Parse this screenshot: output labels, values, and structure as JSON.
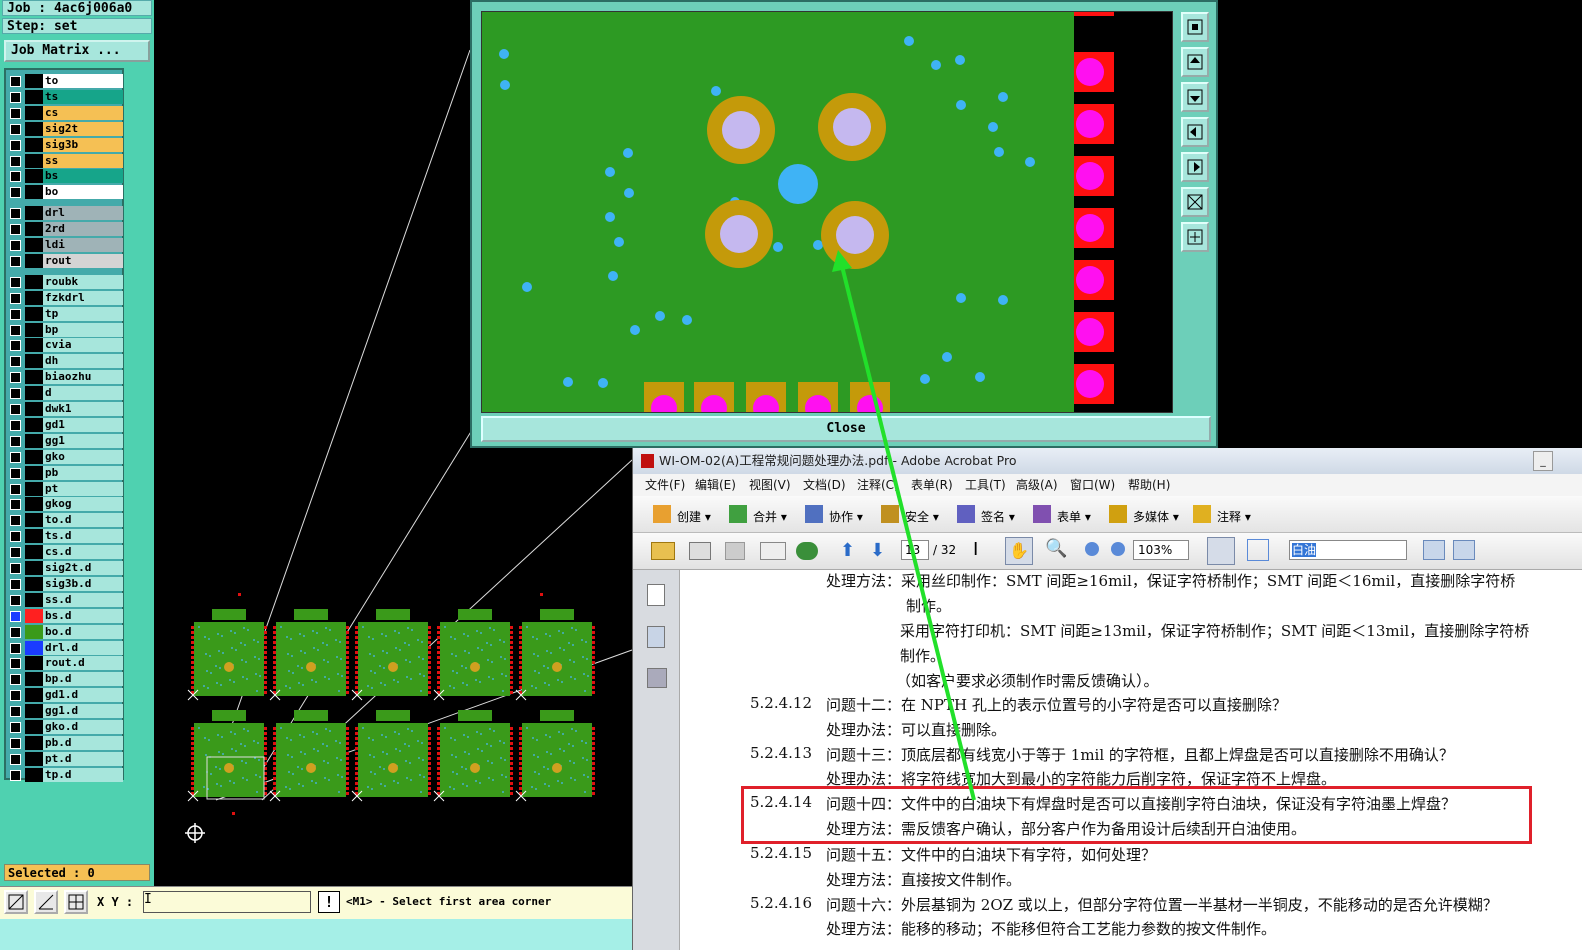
{
  "genesis": {
    "job_line": "Job : 4ac6j006a0",
    "step_line": "Step: set",
    "job_matrix_button": "Job Matrix ...",
    "selected_status": "Selected : 0",
    "xy_label": "X Y :",
    "xy_value": "I",
    "warn_symbol": "!",
    "status_message": "<M1> - Select first area corner",
    "close_button": "Close",
    "layers": [
      {
        "name": "to",
        "color": "#ffffff",
        "sw": "#000000"
      },
      {
        "name": "ts",
        "color": "#16a58a",
        "sw": "#000000"
      },
      {
        "name": "cs",
        "color": "#f5c054",
        "sw": "#000000"
      },
      {
        "name": "sig2t",
        "color": "#f5c054",
        "sw": "#000000"
      },
      {
        "name": "sig3b",
        "color": "#f5c054",
        "sw": "#000000"
      },
      {
        "name": "ss",
        "color": "#f5c054",
        "sw": "#000000"
      },
      {
        "name": "bs",
        "color": "#16a58a",
        "sw": "#000000"
      },
      {
        "name": "bo",
        "color": "#ffffff",
        "sw": "#000000"
      },
      {
        "name": "drl",
        "color": "#9fb3b7",
        "sw": "#000000"
      },
      {
        "name": "2rd",
        "color": "#9fb3b7",
        "sw": "#000000"
      },
      {
        "name": "ldi",
        "color": "#9fb3b7",
        "sw": "#000000"
      },
      {
        "name": "rout",
        "color": "#d4d4d4",
        "sw": "#000000"
      },
      {
        "name": "roubk",
        "color": "#a7e6dc",
        "sw": "#000000"
      },
      {
        "name": "fzkdrl",
        "color": "#a7e6dc",
        "sw": "#000000"
      },
      {
        "name": "tp",
        "color": "#a7e6dc",
        "sw": "#000000"
      },
      {
        "name": "bp",
        "color": "#a7e6dc",
        "sw": "#000000"
      },
      {
        "name": "cvia",
        "color": "#a7e6dc",
        "sw": "#000000"
      },
      {
        "name": "dh",
        "color": "#a7e6dc",
        "sw": "#000000"
      },
      {
        "name": "biaozhu",
        "color": "#a7e6dc",
        "sw": "#000000"
      },
      {
        "name": "d",
        "color": "#a7e6dc",
        "sw": "#000000"
      },
      {
        "name": "dwk1",
        "color": "#a7e6dc",
        "sw": "#000000"
      },
      {
        "name": "gd1",
        "color": "#a7e6dc",
        "sw": "#000000"
      },
      {
        "name": "gg1",
        "color": "#a7e6dc",
        "sw": "#000000"
      },
      {
        "name": "gko",
        "color": "#a7e6dc",
        "sw": "#000000"
      },
      {
        "name": "pb",
        "color": "#a7e6dc",
        "sw": "#000000"
      },
      {
        "name": "pt",
        "color": "#a7e6dc",
        "sw": "#000000"
      },
      {
        "name": "gkog",
        "color": "#a7e6dc",
        "sw": "#000000"
      },
      {
        "name": "to.d",
        "color": "#a7e6dc",
        "sw": "#000000"
      },
      {
        "name": "ts.d",
        "color": "#a7e6dc",
        "sw": "#000000"
      },
      {
        "name": "cs.d",
        "color": "#a7e6dc",
        "sw": "#000000"
      },
      {
        "name": "sig2t.d",
        "color": "#a7e6dc",
        "sw": "#000000"
      },
      {
        "name": "sig3b.d",
        "color": "#a7e6dc",
        "sw": "#000000"
      },
      {
        "name": "ss.d",
        "color": "#a7e6dc",
        "sw": "#000000"
      },
      {
        "name": "bs.d",
        "color": "#a7e6dc",
        "sw": "#ff2020",
        "marker": "#1a3cff"
      },
      {
        "name": "bo.d",
        "color": "#a7e6dc",
        "sw": "#3a9a1a"
      },
      {
        "name": "drl.d",
        "color": "#a7e6dc",
        "sw": "#1a3cff"
      },
      {
        "name": "rout.d",
        "color": "#a7e6dc",
        "sw": "#000000"
      },
      {
        "name": "bp.d",
        "color": "#a7e6dc",
        "sw": "#000000"
      },
      {
        "name": "gd1.d",
        "color": "#a7e6dc",
        "sw": "#000000"
      },
      {
        "name": "gg1.d",
        "color": "#a7e6dc",
        "sw": "#000000"
      },
      {
        "name": "gko.d",
        "color": "#a7e6dc",
        "sw": "#000000"
      },
      {
        "name": "pb.d",
        "color": "#a7e6dc",
        "sw": "#000000"
      },
      {
        "name": "pt.d",
        "color": "#a7e6dc",
        "sw": "#000000"
      },
      {
        "name": "tp.d",
        "color": "#a7e6dc",
        "sw": "#000000"
      }
    ]
  },
  "acrobat": {
    "title": "WI-OM-02(A)工程常规问题处理办法.pdf - Adobe Acrobat Pro",
    "menu": [
      "文件(F)",
      "编辑(E)",
      "视图(V)",
      "文档(D)",
      "注释(C)",
      "表单(R)",
      "工具(T)",
      "高级(A)",
      "窗口(W)",
      "帮助(H)"
    ],
    "toolbar1": [
      "创建",
      "合并",
      "协作",
      "安全",
      "签名",
      "表单",
      "多媒体",
      "注释"
    ],
    "page_current": "13",
    "page_total": "/ 32",
    "zoom": "103%",
    "search_value": "白油",
    "doc_lines": [
      {
        "num": "",
        "text": "处理方法：采用丝印制作：SMT 间距≥16mil，保证字符桥制作；SMT 间距＜16mil，直接删除字符桥"
      },
      {
        "num": "",
        "text": "制作。"
      },
      {
        "num": "",
        "text": "采用字符打印机：SMT 间距≥13mil，保证字符桥制作；SMT 间距＜13mil，直接删除字符桥"
      },
      {
        "num": "",
        "text": "制作。"
      },
      {
        "num": "",
        "text": "（如客户要求必须制作时需反馈确认）。"
      },
      {
        "num": "5.2.4.12",
        "text": "问题十二：在 NPTH 孔上的表示位置号的小字符是否可以直接删除？"
      },
      {
        "num": "",
        "text": "处理办法：可以直接删除。"
      },
      {
        "num": "5.2.4.13",
        "text": "问题十三：顶底层都有线宽小于等于 1mil 的字符框，且都上焊盘是否可以直接删除不用确认？"
      },
      {
        "num": "",
        "text": "处理办法：将字符线宽加大到最小的字符能力后削字符，保证字符不上焊盘。"
      },
      {
        "num": "5.2.4.14",
        "text": "问题十四：文件中的白油块下有焊盘时是否可以直接削字符白油块，保证没有字符油墨上焊盘？"
      },
      {
        "num": "",
        "text": "处理方法：需反馈客户确认，部分客户作为备用设计后续刮开白油使用。"
      },
      {
        "num": "5.2.4.15",
        "text": "问题十五：文件中的白油块下有字符，如何处理？"
      },
      {
        "num": "",
        "text": "处理方法：直接按文件制作。"
      },
      {
        "num": "5.2.4.16",
        "text": "问题十六：外层基铜为 2OZ 或以上，但部分字符位置一半基材一半铜皮，不能移动的是否允许模糊？"
      },
      {
        "num": "",
        "text": "处理方法：能移的移动；不能移但符合工艺能力参数的按文件制作。"
      }
    ]
  }
}
